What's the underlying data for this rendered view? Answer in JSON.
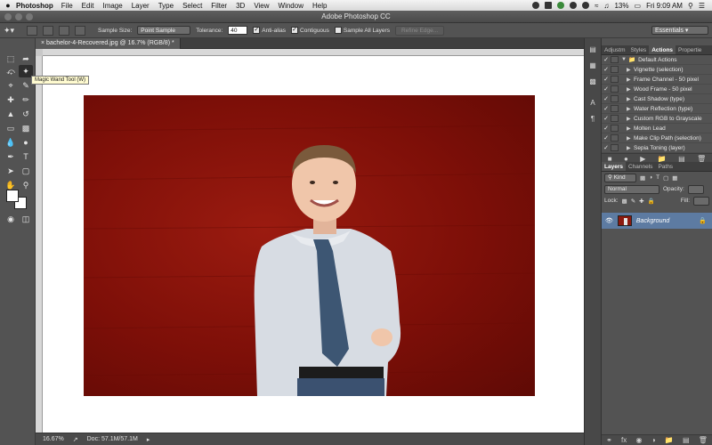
{
  "menubar": {
    "app_name": "Photoshop",
    "items": [
      "File",
      "Edit",
      "Image",
      "Layer",
      "Type",
      "Select",
      "Filter",
      "3D",
      "View",
      "Window",
      "Help"
    ],
    "battery": "13%",
    "clock": "Fri 9:09 AM"
  },
  "window": {
    "title": "Adobe Photoshop CC"
  },
  "options": {
    "sample_size_label": "Sample Size:",
    "sample_size_value": "Point Sample",
    "tolerance_label": "Tolerance:",
    "tolerance_value": "40",
    "anti_alias_label": "Anti-alias",
    "contiguous_label": "Contiguous",
    "sample_all_layers_label": "Sample All Layers",
    "refine_edge_label": "Refine Edge...",
    "workspace": "Essentials"
  },
  "toolbox": {
    "tooltip": "Magic Wand Tool (W)"
  },
  "document": {
    "tab_title": "bachelor-4-Recovered.jpg @ 16.7% (RGB/8) *"
  },
  "status": {
    "zoom": "16.67%",
    "doc_info": "Doc: 57.1M/57.1M"
  },
  "actions_panel": {
    "tabs": [
      "Adjustm",
      "Styles",
      "Actions",
      "Propertie"
    ],
    "active_tab": "Actions",
    "set_name": "Default Actions",
    "items": [
      "Vignette (selection)",
      "Frame Channel - 50 pixel",
      "Wood Frame - 50 pixel",
      "Cast Shadow (type)",
      "Water Reflection (type)",
      "Custom RGB to Grayscale",
      "Molten Lead",
      "Make Clip Path (selection)",
      "Sepia Toning (layer)"
    ]
  },
  "layers_panel": {
    "tabs": [
      "Layers",
      "Channels",
      "Paths"
    ],
    "active_tab": "Layers",
    "kind_label": "Kind",
    "blend_mode": "Normal",
    "opacity_label": "Opacity:",
    "lock_label": "Lock:",
    "fill_label": "Fill:",
    "layer_name": "Background"
  }
}
